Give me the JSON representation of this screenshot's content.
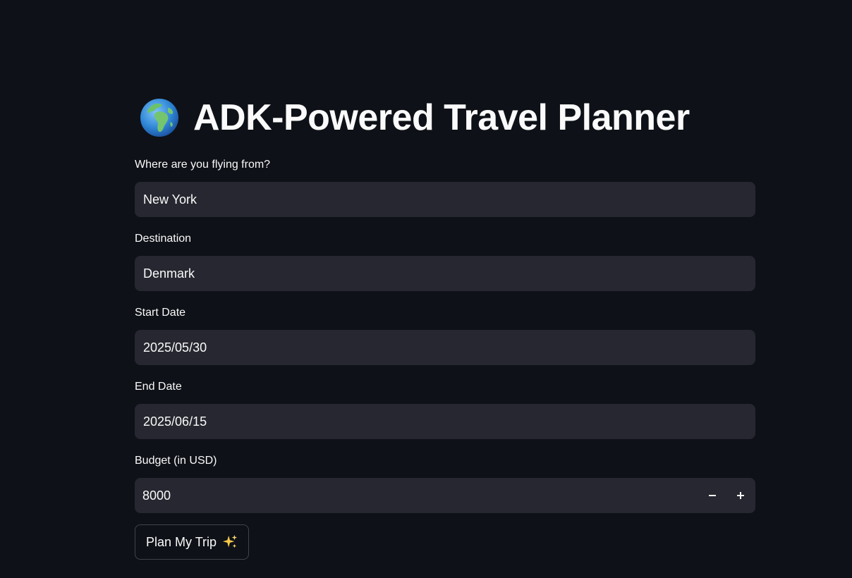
{
  "app": {
    "title": "ADK-Powered Travel Planner",
    "title_icon": "globe-europe-africa-icon"
  },
  "form": {
    "origin": {
      "label": "Where are you flying from?",
      "value": "New York"
    },
    "destination": {
      "label": "Destination",
      "value": "Denmark"
    },
    "start_date": {
      "label": "Start Date",
      "value": "2025/05/30"
    },
    "end_date": {
      "label": "End Date",
      "value": "2025/06/15"
    },
    "budget": {
      "label": "Budget (in USD)",
      "value": "8000",
      "decrement_icon": "minus-icon",
      "increment_icon": "plus-icon"
    },
    "submit": {
      "label": "Plan My Trip",
      "icon": "sparkles-icon"
    }
  },
  "colors": {
    "background": "#0e1117",
    "input_background": "#262730",
    "text": "#fafafa"
  }
}
